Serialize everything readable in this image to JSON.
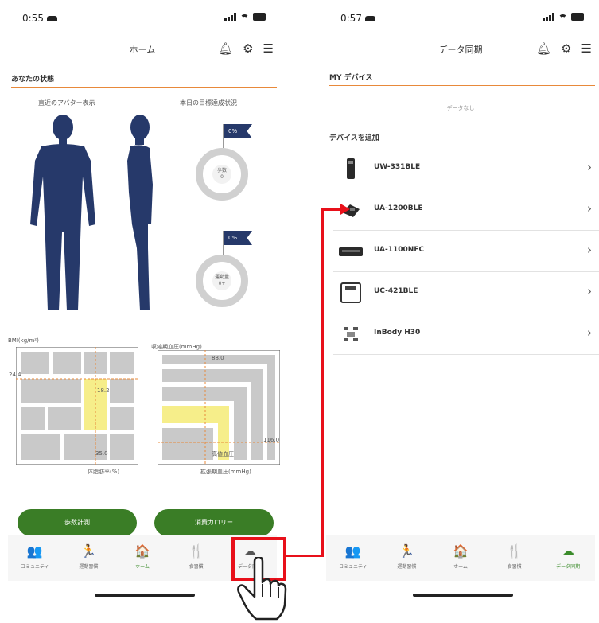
{
  "left": {
    "status": {
      "time": "0:55"
    },
    "nav": {
      "title": "ホーム"
    },
    "section_title": "あなたの状態",
    "avatar_label": "直近のアバター表示",
    "goal_label": "本日の目標達成状況",
    "goals": [
      {
        "percent": "0%",
        "name": "歩数",
        "value": "0"
      },
      {
        "percent": "0%",
        "name": "運動量",
        "value": "0+"
      }
    ],
    "bmi_chart": {
      "title": "BMI(kg/m²)",
      "y_value": "24.4",
      "mark_value": "18.2",
      "x_value": "35.0",
      "xlabel": "体脂肪率(%)"
    },
    "bp_chart": {
      "title": "収縮期血圧(mmHg)",
      "top_value": "88.0",
      "right_value": "116.0",
      "zone_label": "高値血圧",
      "xlabel": "拡張期血圧(mmHg)"
    },
    "buttons": {
      "steps": "歩数計測",
      "calories": "消費カロリー"
    },
    "tabs": [
      {
        "icon": "community-icon",
        "glyph": "👥",
        "label": "コミュニティ",
        "active": false
      },
      {
        "icon": "exercise-icon",
        "glyph": "🏃",
        "label": "運動習慣",
        "active": false
      },
      {
        "icon": "home-icon",
        "glyph": "🏠",
        "label": "ホーム",
        "active": true
      },
      {
        "icon": "meal-icon",
        "glyph": "🍴",
        "label": "食習慣",
        "active": false
      },
      {
        "icon": "cloud-upload-icon",
        "glyph": "☁",
        "label": "データ同期",
        "active": false
      }
    ]
  },
  "right": {
    "status": {
      "time": "0:57"
    },
    "nav": {
      "title": "データ同期"
    },
    "my_devices_title": "MY デバイス",
    "empty_text": "データなし",
    "add_device_title": "デバイスを追加",
    "devices": [
      {
        "name": "UW-331BLE"
      },
      {
        "name": "UA-1200BLE"
      },
      {
        "name": "UA-1100NFC"
      },
      {
        "name": "UC-421BLE"
      },
      {
        "name": "InBody H30"
      }
    ],
    "tabs": [
      {
        "icon": "community-icon",
        "glyph": "👥",
        "label": "コミュニティ",
        "active": false
      },
      {
        "icon": "exercise-icon",
        "glyph": "🏃",
        "label": "運動習慣",
        "active": false
      },
      {
        "icon": "home-icon",
        "glyph": "🏠",
        "label": "ホーム",
        "active": false
      },
      {
        "icon": "meal-icon",
        "glyph": "🍴",
        "label": "食習慣",
        "active": false
      },
      {
        "icon": "cloud-upload-icon",
        "glyph": "☁",
        "label": "データ同期",
        "active": true
      }
    ]
  },
  "colors": {
    "accent_green": "#3a7d26",
    "divider_orange": "#e8893a",
    "avatar_navy": "#26396a",
    "highlight_red": "#e8101a",
    "chart_yellow": "#f6ee8a"
  }
}
